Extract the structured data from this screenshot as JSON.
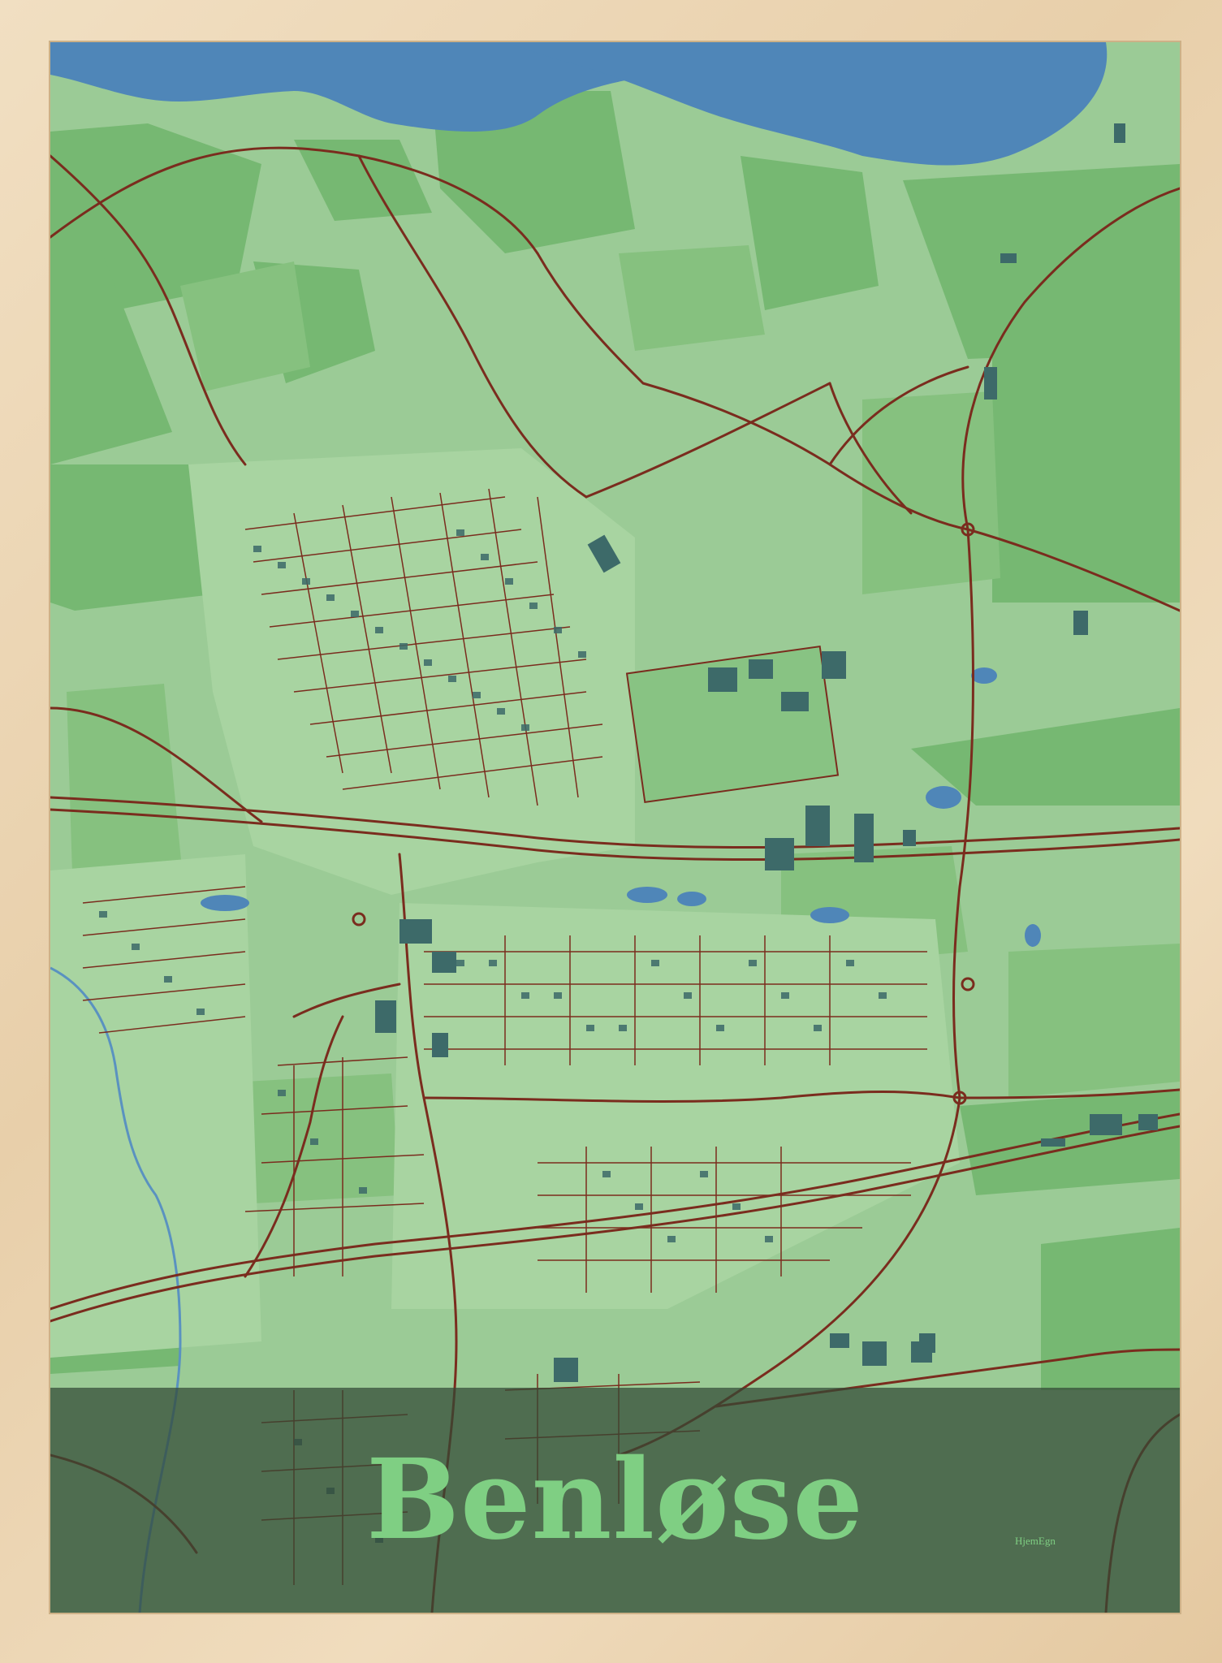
{
  "poster": {
    "city_name": "Benløse",
    "brand_mark": "HjemEgn"
  },
  "colors": {
    "frame_wood": "#ecd5b2",
    "land_light": "#9bcb96",
    "land_mid": "#86c17f",
    "land_dark": "#6fb36c",
    "water": "#4f86b8",
    "roads": "#7a2c1e",
    "buildings": "#3d6a69",
    "banner": "#324834",
    "title_text": "#7fcf83"
  },
  "icons": {
    "water_body": "lake-shape",
    "settlement": "building-blocks"
  }
}
